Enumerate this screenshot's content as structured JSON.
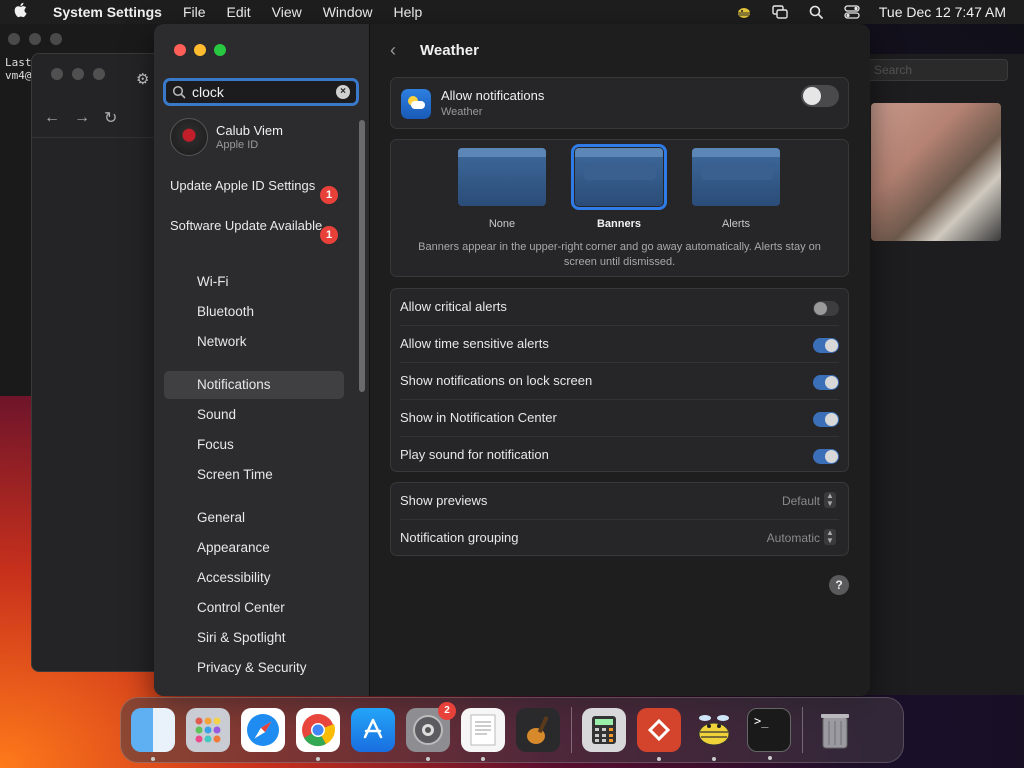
{
  "menubar": {
    "app_name": "System Settings",
    "menus": [
      "File",
      "Edit",
      "View",
      "Window",
      "Help"
    ],
    "clock": "Tue Dec 12  7:47 AM"
  },
  "bg_terminal": {
    "line1": "Last",
    "line2": "vm4@"
  },
  "bg_right": {
    "search_placeholder": "Search"
  },
  "sidebar": {
    "search": {
      "value": "clock",
      "placeholder": "Search"
    },
    "account": {
      "name": "Calub Viem",
      "sub": "Apple ID"
    },
    "alerts": [
      {
        "label": "Update Apple ID Settings",
        "badge": "1"
      },
      {
        "label": "Software Update Available",
        "badge": "1"
      }
    ],
    "items": [
      {
        "label": "Wi-Fi"
      },
      {
        "label": "Bluetooth"
      },
      {
        "label": "Network"
      },
      {
        "label": "Notifications"
      },
      {
        "label": "Sound"
      },
      {
        "label": "Focus"
      },
      {
        "label": "Screen Time"
      },
      {
        "label": "General"
      },
      {
        "label": "Appearance"
      },
      {
        "label": "Accessibility"
      },
      {
        "label": "Control Center"
      },
      {
        "label": "Siri & Spotlight"
      },
      {
        "label": "Privacy & Security"
      }
    ]
  },
  "content": {
    "title": "Weather",
    "allow": {
      "label": "Allow notifications",
      "sub": "Weather",
      "on": false
    },
    "styles": {
      "options": [
        {
          "label": "None"
        },
        {
          "label": "Banners"
        },
        {
          "label": "Alerts"
        }
      ],
      "selected": "Banners",
      "description": "Banners appear in the upper-right corner and go away automatically. Alerts stay on screen until dismissed."
    },
    "toggles": [
      {
        "label": "Allow critical alerts",
        "on": false
      },
      {
        "label": "Allow time sensitive alerts",
        "on": true
      },
      {
        "label": "Show notifications on lock screen",
        "on": true
      },
      {
        "label": "Show in Notification Center",
        "on": true
      },
      {
        "label": "Play sound for notification",
        "on": true
      }
    ],
    "selects": [
      {
        "label": "Show previews",
        "value": "Default"
      },
      {
        "label": "Notification grouping",
        "value": "Automatic"
      }
    ],
    "help": "?"
  },
  "dock": {
    "sysprefs_badge": "2"
  }
}
